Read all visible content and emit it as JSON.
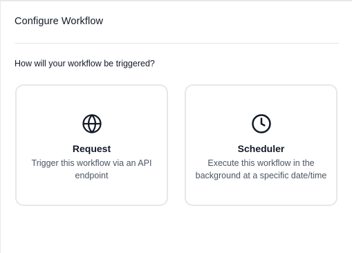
{
  "dialog": {
    "title": "Configure Workflow",
    "question": "How will your workflow be triggered?"
  },
  "options": [
    {
      "title": "Request",
      "description": "Trigger this workflow via an API endpoint",
      "icon": "globe-icon"
    },
    {
      "title": "Scheduler",
      "description": "Execute this workflow in the background at a specific date/time",
      "icon": "clock-icon"
    }
  ],
  "colors": {
    "border": "#e5e7eb",
    "text_primary": "#111827",
    "text_secondary": "#4b5563"
  }
}
